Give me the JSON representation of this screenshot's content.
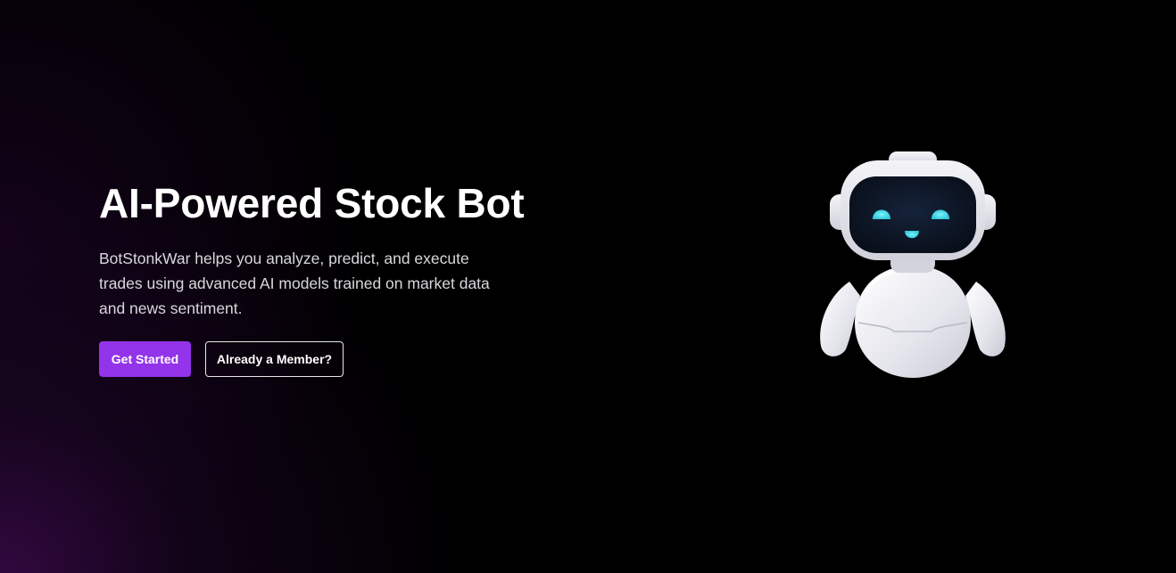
{
  "hero": {
    "title": "AI-Powered Stock Bot",
    "description": "BotStonkWar helps you analyze, predict, and execute trades using advanced AI models trained on market data and news sentiment.",
    "primary_button": "Get Started",
    "secondary_button": "Already a Member?"
  },
  "illustration": {
    "icon": "robot-mascot-icon"
  },
  "colors": {
    "background": "#000000",
    "glow": "#3a0a4a",
    "accent": "#9333ea",
    "robot_eye": "#4fe0ee"
  }
}
